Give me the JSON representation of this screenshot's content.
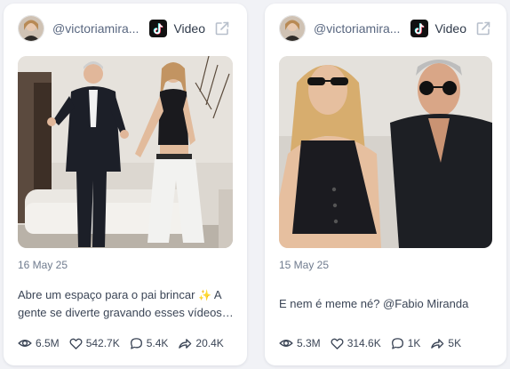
{
  "cards": [
    {
      "handle": "@victoriamira...",
      "type_label": "Video",
      "date": "16 May 25",
      "caption_lead": "Abre um espaço para o pai brincar",
      "caption_emoji": "✨",
      "caption_tail": " A gente se diverte gravando esses vídeos…",
      "stats": {
        "views": "6.5M",
        "likes": "542.7K",
        "comments": "5.4K",
        "shares": "20.4K"
      }
    },
    {
      "handle": "@victoriamira...",
      "type_label": "Video",
      "date": "15 May 25",
      "caption": "E nem é meme né? @Fabio Miranda",
      "stats": {
        "views": "5.3M",
        "likes": "314.6K",
        "comments": "1K",
        "shares": "5K"
      }
    }
  ],
  "icons": {
    "platform": "tiktok-icon",
    "external": "external-link-icon",
    "views": "eye-icon",
    "likes": "heart-icon",
    "comments": "comment-icon",
    "shares": "share-icon"
  },
  "colors": {
    "card_bg": "#ffffff",
    "page_bg": "#f1f2f6",
    "muted_text": "#6f7b8e",
    "body_text": "#3b4556"
  }
}
